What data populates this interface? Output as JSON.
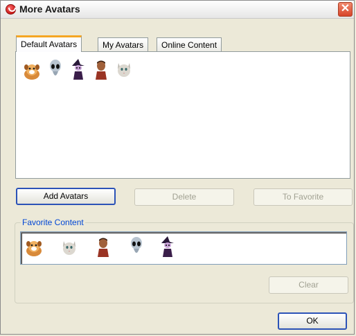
{
  "window": {
    "title": "More Avatars",
    "close_symbol": "✕"
  },
  "tabs": [
    {
      "label": "Default Avatars",
      "active": true
    },
    {
      "label": "My Avatars",
      "active": false
    },
    {
      "label": "Online Content",
      "active": false
    }
  ],
  "default_avatars": [
    "dog-avatar-icon",
    "alien-avatar-icon",
    "witch-avatar-icon",
    "man-avatar-icon",
    "cat-avatar-icon"
  ],
  "buttons": {
    "add_avatars": "Add Avatars",
    "delete": "Delete",
    "to_favorite": "To Favorite",
    "clear": "Clear",
    "ok": "OK"
  },
  "favorites": {
    "label": "Favorite Content",
    "avatars": [
      "dog-avatar-icon",
      "cat-avatar-icon",
      "man-avatar-icon",
      "alien-avatar-icon",
      "witch-avatar-icon"
    ]
  },
  "colors": {
    "accent_tab": "#f5a623",
    "group_label": "#0046d5",
    "close": "#d8452a"
  }
}
